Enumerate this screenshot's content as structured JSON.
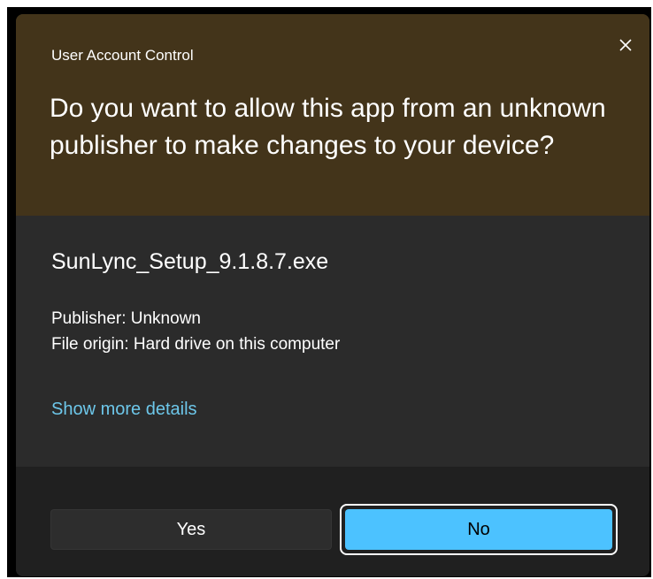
{
  "dialog": {
    "title": "User Account Control",
    "question": "Do you want to allow this app from an unknown publisher to make changes to your device?",
    "app_name": "SunLync_Setup_9.1.8.7.exe",
    "publisher": "Publisher: Unknown",
    "file_origin": "File origin: Hard drive on this computer",
    "details_link": "Show more details",
    "close_icon": "close-icon"
  },
  "buttons": {
    "yes_label": "Yes",
    "no_label": "No"
  },
  "colors": {
    "header_bg": "#43341a",
    "body_bg": "#2b2b2b",
    "footer_bg": "#202020",
    "accent": "#4cc2ff",
    "link": "#6dc7ea"
  }
}
